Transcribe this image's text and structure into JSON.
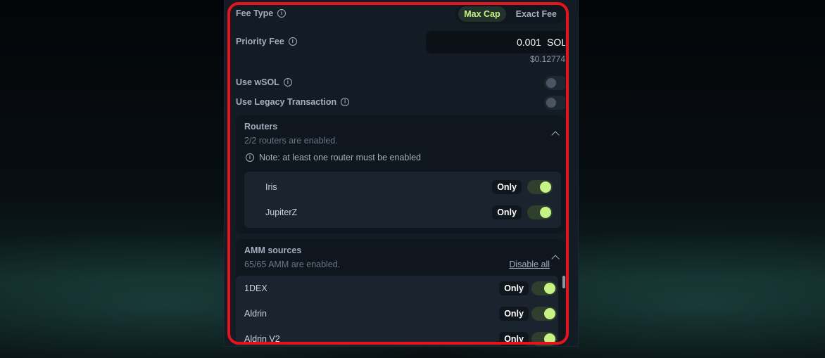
{
  "fee_type": {
    "label": "Fee Type",
    "options": [
      "Max Cap",
      "Exact Fee"
    ],
    "selected": "Max Cap"
  },
  "priority_fee": {
    "label": "Priority Fee",
    "value": "0.001",
    "unit": "SOL",
    "usd": "$0.12774"
  },
  "use_wsol": {
    "label": "Use wSOL"
  },
  "use_legacy": {
    "label": "Use Legacy Transaction"
  },
  "routers": {
    "title": "Routers",
    "subtitle": "2/2 routers are enabled.",
    "note": "Note: at least one router must be enabled",
    "items": [
      {
        "name": "Iris",
        "only": "Only"
      },
      {
        "name": "JupiterZ",
        "only": "Only"
      }
    ]
  },
  "amm": {
    "title": "AMM sources",
    "subtitle": "65/65 AMM are enabled.",
    "disable_all": "Disable all",
    "items": [
      {
        "name": "1DEX",
        "only": "Only"
      },
      {
        "name": "Aldrin",
        "only": "Only"
      },
      {
        "name": "Aldrin V2",
        "only": "Only"
      }
    ]
  },
  "colors": {
    "accent": "#c7f284",
    "highlight": "#e3141b",
    "panel": "#131b24"
  }
}
